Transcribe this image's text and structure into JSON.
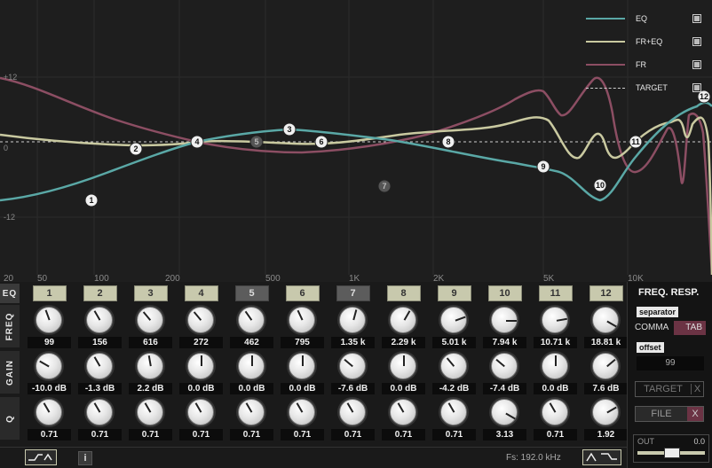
{
  "graph": {
    "y_labels": [
      "+12",
      "0",
      "-12"
    ],
    "x_labels": [
      "20",
      "50",
      "100",
      "200",
      "500",
      "1K",
      "2K",
      "5K",
      "10K"
    ],
    "legend": [
      {
        "label": "EQ",
        "color": "#5aa8a6"
      },
      {
        "label": "FR+EQ",
        "color": "#c9c9a0"
      },
      {
        "label": "FR",
        "color": "#8c4e63"
      },
      {
        "label": "TARGET",
        "color": "#cfcfcf"
      }
    ],
    "nodes": [
      "1",
      "2",
      "4",
      "5",
      "3",
      "6",
      "7",
      "8",
      "9",
      "10",
      "11",
      "12"
    ]
  },
  "panel": {
    "tabs": {
      "eq": "EQ",
      "freq": "FREQ",
      "gain": "GAIN",
      "q": "Q"
    },
    "bands": [
      {
        "num": "1",
        "freq": "99",
        "gain": "-10.0 dB",
        "q": "0.71"
      },
      {
        "num": "2",
        "freq": "156",
        "gain": "-1.3 dB",
        "q": "0.71"
      },
      {
        "num": "3",
        "freq": "616",
        "gain": "2.2 dB",
        "q": "0.71"
      },
      {
        "num": "4",
        "freq": "272",
        "gain": "0.0 dB",
        "q": "0.71"
      },
      {
        "num": "5",
        "freq": "462",
        "gain": "0.0 dB",
        "q": "0.71"
      },
      {
        "num": "6",
        "freq": "795",
        "gain": "0.0 dB",
        "q": "0.71"
      },
      {
        "num": "7",
        "freq": "1.35 k",
        "gain": "-7.6 dB",
        "q": "0.71"
      },
      {
        "num": "8",
        "freq": "2.29 k",
        "gain": "0.0 dB",
        "q": "0.71"
      },
      {
        "num": "9",
        "freq": "5.01 k",
        "gain": "-4.2 dB",
        "q": "0.71"
      },
      {
        "num": "10",
        "freq": "7.94 k",
        "gain": "-7.4 dB",
        "q": "3.13"
      },
      {
        "num": "11",
        "freq": "10.71 k",
        "gain": "0.0 dB",
        "q": "0.71"
      },
      {
        "num": "12",
        "freq": "18.81 k",
        "gain": "7.6 dB",
        "q": "1.92"
      }
    ],
    "right": {
      "title": "FREQ. RESP.",
      "separator_label": "separator",
      "opt_comma": "COMMA",
      "opt_tab": "TAB",
      "offset_label": "offset",
      "offset_value": "99",
      "target_btn": "TARGET",
      "target_x": "X",
      "file_btn": "FILE",
      "file_x": "X"
    },
    "bottom": {
      "info": "i",
      "fs": "Fs: 192.0 kHz",
      "out_label": "OUT",
      "out_value": "0.0"
    }
  }
}
